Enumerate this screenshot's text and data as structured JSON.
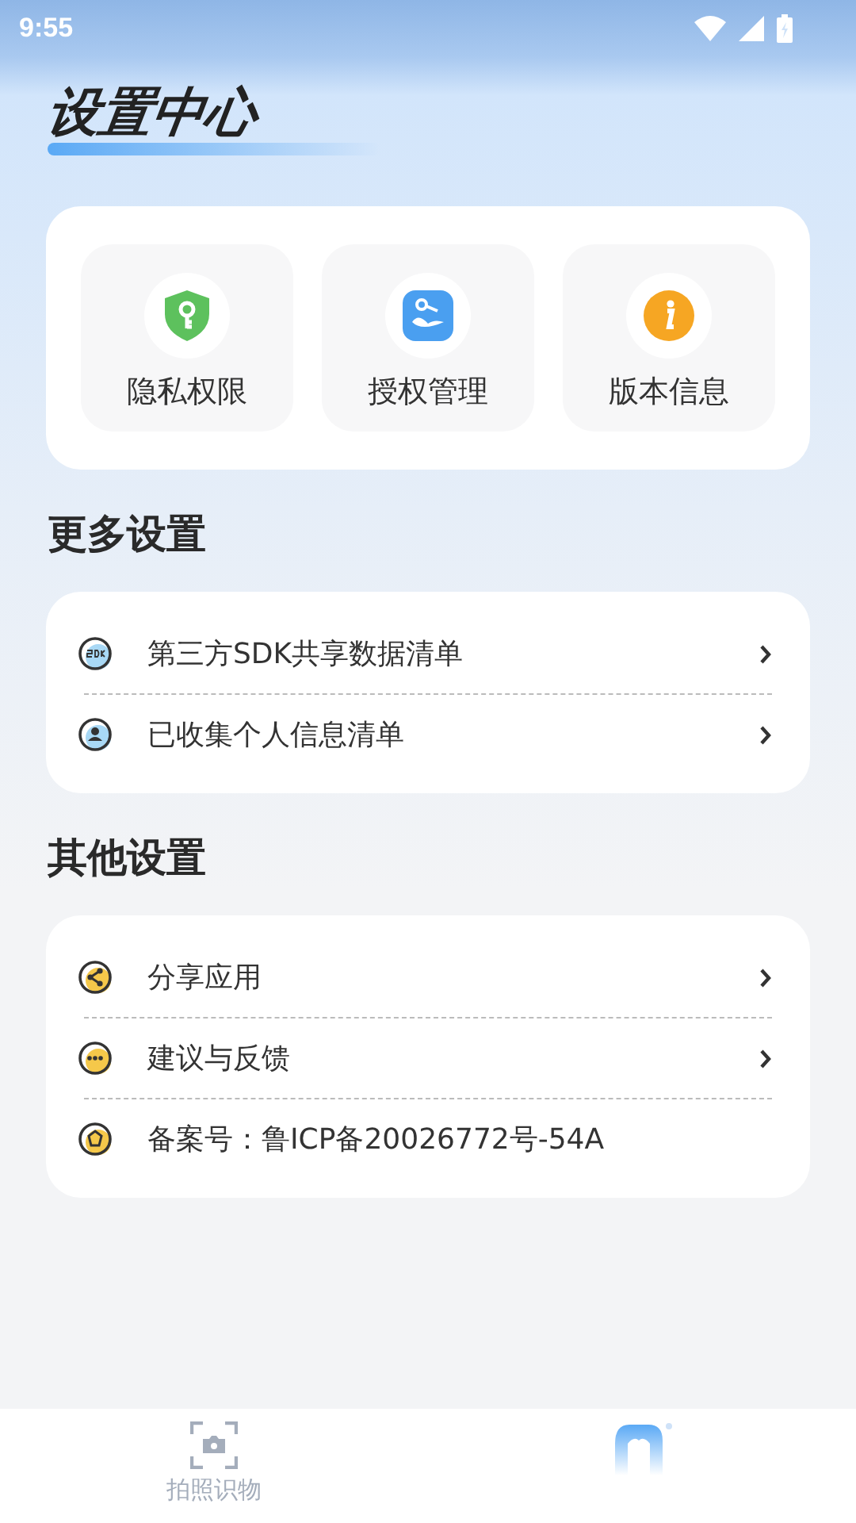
{
  "status_bar": {
    "time": "9:55"
  },
  "title": "设置中心",
  "shortcuts": [
    {
      "label": "隐私权限"
    },
    {
      "label": "授权管理"
    },
    {
      "label": "版本信息"
    }
  ],
  "sections": [
    {
      "heading": "更多设置",
      "items": [
        {
          "label": "第三方SDK共享数据清单",
          "kind": "link"
        },
        {
          "label": "已收集个人信息清单",
          "kind": "link"
        }
      ]
    },
    {
      "heading": "其他设置",
      "items": [
        {
          "label": "分享应用",
          "kind": "link"
        },
        {
          "label": "建议与反馈",
          "kind": "link"
        },
        {
          "label": "备案号：鲁ICP备20026772号-54A",
          "kind": "info"
        }
      ]
    }
  ],
  "tabs": [
    {
      "label": "拍照识物",
      "selected": false
    },
    {
      "selected": true
    }
  ]
}
